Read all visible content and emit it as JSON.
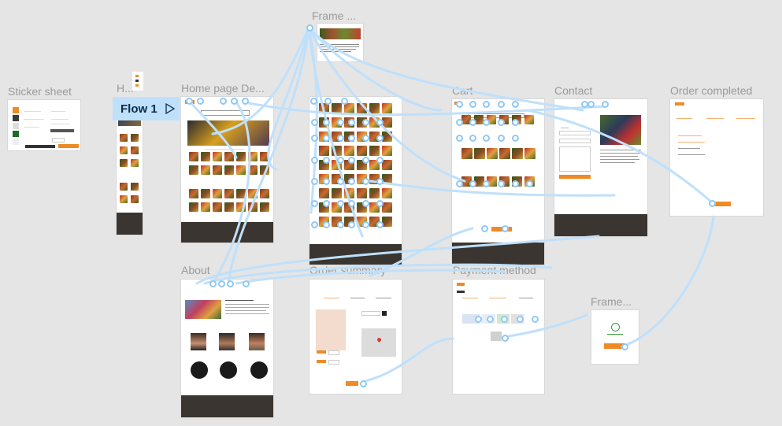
{
  "frames": {
    "sticker_sheet": "Sticker sheet",
    "h_frame": "H...",
    "home_page": "Home page De...",
    "frame_top": "Frame ...",
    "cart": "Cart",
    "contact": "Contact",
    "order_completed": "Order completed",
    "about": "About",
    "order_summary": "Order summary",
    "payment_method": "Payment method",
    "frame_bottom": "Frame..."
  },
  "flow": {
    "label": "Flow 1",
    "icon": "cursor-arrow-icon"
  },
  "colors": {
    "accent": "#f08a24",
    "canvas": "#e5e5e5",
    "wire": "#bfe0fb",
    "footer": "#3a3530"
  }
}
